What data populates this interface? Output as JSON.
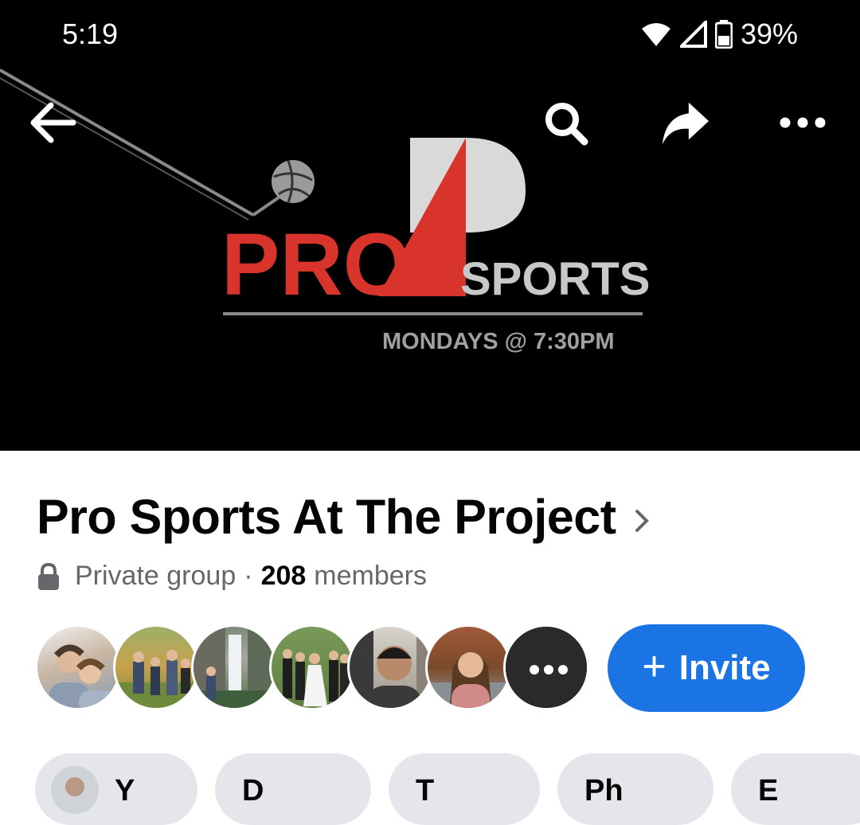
{
  "status_bar": {
    "time": "5:19",
    "battery": "39%"
  },
  "appbar": {
    "back_icon": "arrow-left-icon",
    "search_icon": "search-icon",
    "share_icon": "share-arrow-icon",
    "more_icon": "more-dots-icon"
  },
  "cover": {
    "logo_text_pro": "PRO",
    "logo_text_sports": "SPORTS",
    "tagline": "MONDAYS @ 7:30PM"
  },
  "group": {
    "title": "Pro Sports At The Project",
    "privacy": "Private group",
    "separator": "·",
    "member_count": "208",
    "members_label": "members"
  },
  "invite_button": {
    "plus": "+",
    "label": "Invite"
  },
  "more_members_label": "•••",
  "tabs": [
    {
      "label": "Y"
    },
    {
      "label": "D"
    },
    {
      "label": "T"
    },
    {
      "label": "Ph"
    },
    {
      "label": "E"
    }
  ],
  "colors": {
    "accent": "#1b74e4",
    "logo_red": "#d9342b",
    "cover_bg": "#000000"
  }
}
